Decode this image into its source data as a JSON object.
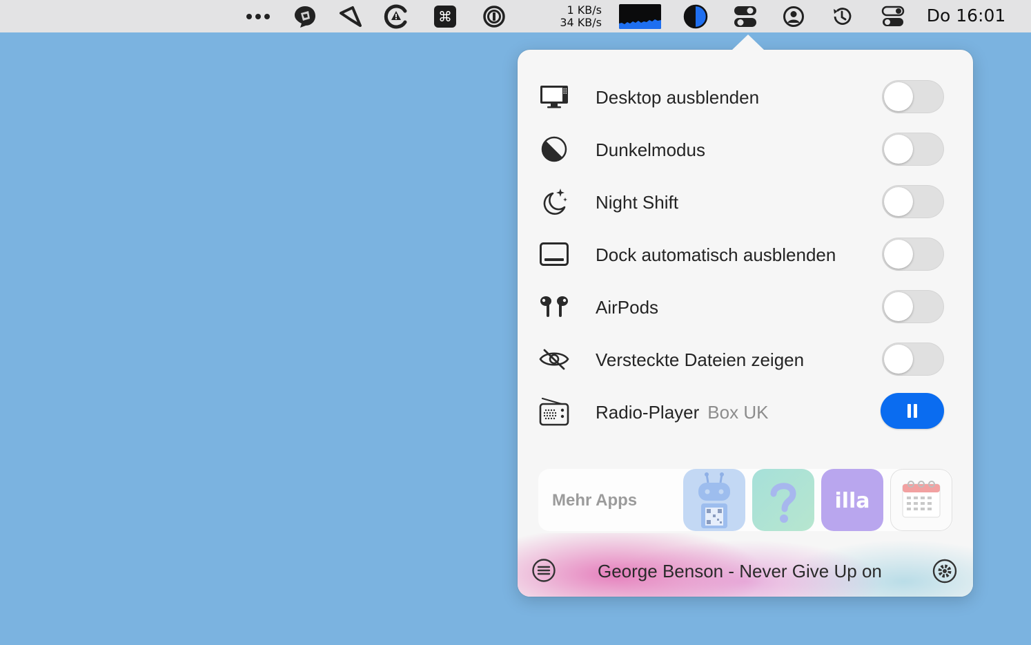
{
  "menubar": {
    "net_up": "1 KB/s",
    "net_down": "34 KB/s",
    "clock": "Do 16:01",
    "icons": [
      "more-icon",
      "pointer-icon",
      "shape-icon",
      "warning-c-icon",
      "command-icon",
      "onepassword-icon",
      "network-graph-icon",
      "contrast-icon",
      "toggles-icon",
      "user-icon",
      "history-icon",
      "control-center-icon"
    ]
  },
  "panel": {
    "rows": [
      {
        "label": "Desktop ausblenden",
        "icon": "desktop-icon",
        "on": false
      },
      {
        "label": "Dunkelmodus",
        "icon": "dark-mode-icon",
        "on": false
      },
      {
        "label": "Night Shift",
        "icon": "night-shift-icon",
        "on": false
      },
      {
        "label": "Dock automatisch ausblenden",
        "icon": "dock-icon",
        "on": false
      },
      {
        "label": "AirPods",
        "icon": "airpods-icon",
        "on": false
      },
      {
        "label": "Versteckte Dateien zeigen",
        "icon": "hidden-files-icon",
        "on": false
      }
    ],
    "radio": {
      "label": "Radio-Player",
      "station": "Box UK",
      "state": "playing"
    },
    "more_apps": {
      "label": "Mehr Apps",
      "apps": [
        {
          "name": "qr-robot-app-icon"
        },
        {
          "name": "question-app-icon"
        },
        {
          "name": "illa-app-icon",
          "text": "illa"
        },
        {
          "name": "calendar-app-icon"
        }
      ]
    },
    "now_playing": "George Benson - Never Give Up on a Good Thing"
  },
  "colors": {
    "accent": "#0a6cf0",
    "desktop": "#7bb3e0",
    "menubar": "#e3e3e4"
  }
}
